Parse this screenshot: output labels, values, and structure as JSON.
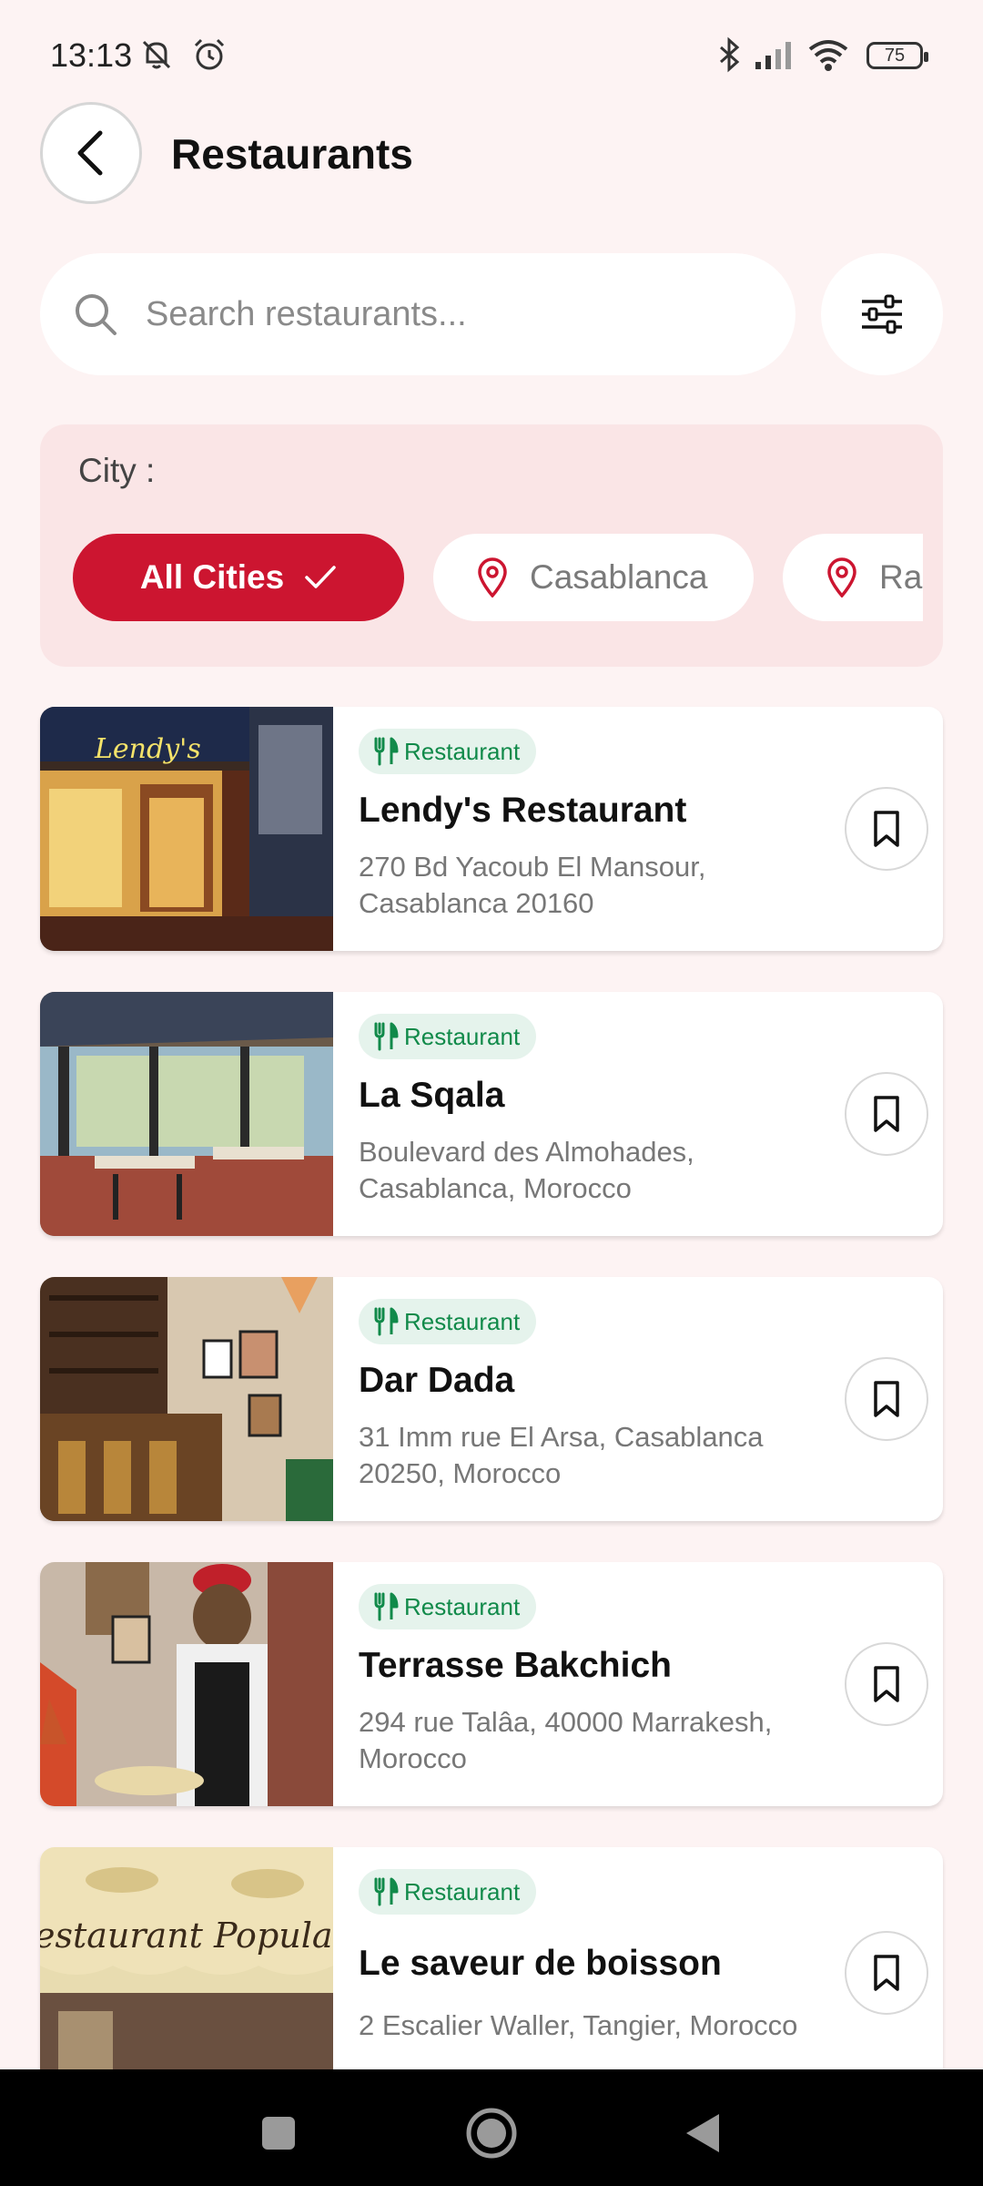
{
  "status_bar": {
    "time": "13:13",
    "battery": "75"
  },
  "header": {
    "title": "Restaurants"
  },
  "search": {
    "placeholder": "Search restaurants..."
  },
  "city_filter": {
    "label": "City :",
    "chips": [
      {
        "label": "All Cities",
        "selected": true
      },
      {
        "label": "Casablanca",
        "selected": false
      },
      {
        "label": "Rabat",
        "selected": false
      }
    ]
  },
  "restaurants": [
    {
      "tag": "Restaurant",
      "name": "Lendy's Restaurant",
      "address": "270 Bd Yacoub El Mansour, Casablanca 20160"
    },
    {
      "tag": "Restaurant",
      "name": "La Sqala",
      "address": "Boulevard des Almohades, Casablanca, Morocco"
    },
    {
      "tag": "Restaurant",
      "name": "Dar Dada",
      "address": "31 Imm rue El Arsa, Casablanca 20250, Morocco"
    },
    {
      "tag": "Restaurant",
      "name": "Terrasse Bakchich",
      "address": "294 rue Talâa, 40000 Marrakesh, Morocco"
    },
    {
      "tag": "Restaurant",
      "name": "Le saveur de boisson",
      "address": "2 Escalier Waller, Tangier, Morocco"
    }
  ],
  "images": {
    "card1_sign": "Lendy's",
    "card5_sign": "estaurant Populaire"
  },
  "colors": {
    "accent": "#cc1530",
    "tag_bg": "#e5f3ec",
    "tag_text": "#118a4a",
    "background": "#fdf3f3"
  }
}
